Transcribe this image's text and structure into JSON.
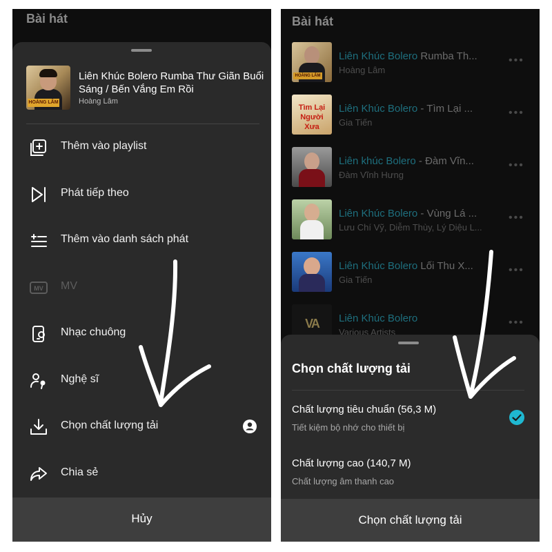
{
  "left": {
    "section_title": "Bài hát",
    "song": {
      "title": "Liên Khúc Bolero Rumba Thư Giãn Buổi Sáng / Bến Vắng Em Rồi",
      "artist": "Hoàng Lâm",
      "cover_name": "HOÀNG LÂM"
    },
    "menu": [
      {
        "label": "Thêm vào playlist",
        "icon": "add-to-playlist-icon"
      },
      {
        "label": "Phát tiếp theo",
        "icon": "play-next-icon"
      },
      {
        "label": "Thêm vào danh sách phát",
        "icon": "add-to-queue-icon"
      },
      {
        "label": "MV",
        "icon": "mv-icon",
        "disabled": true
      },
      {
        "label": "Nhạc chuông",
        "icon": "ringtone-icon"
      },
      {
        "label": "Nghệ sĩ",
        "icon": "artist-icon"
      },
      {
        "label": "Chọn chất lượng tải",
        "icon": "download-icon",
        "badge": "account-lock-icon"
      },
      {
        "label": "Chia sẻ",
        "icon": "share-icon"
      }
    ],
    "cancel_label": "Hủy"
  },
  "right": {
    "section_title": "Bài hát",
    "songs": [
      {
        "title_highlight": "Liên Khúc Bolero",
        "title_rest": " Rumba Th...",
        "subtitle": "Hoàng Lâm",
        "dots": "•••",
        "thumb_text": "HOÀNG LÂM"
      },
      {
        "title_highlight": "Liên Khúc Bolero",
        "title_rest": " - Tìm Lại ...",
        "subtitle": "Gia Tiến",
        "dots": "•••",
        "thumb_text": "Tìm Lại Người Xưa"
      },
      {
        "title_highlight": "Liên khúc Bolero",
        "title_rest": " - Đàm Vĩn...",
        "subtitle": "Đàm Vĩnh Hưng",
        "dots": "•••",
        "thumb_text": ""
      },
      {
        "title_highlight": "Liên Khúc Bolero",
        "title_rest": " - Vùng Lá ...",
        "subtitle": "Lưu Chí Vỹ, Diễm Thùy, Lý Diệu L...",
        "dots": "•••",
        "thumb_text": ""
      },
      {
        "title_highlight": "Liên Khúc Bolero",
        "title_rest": " Lối Thu X...",
        "subtitle": "Gia Tiến",
        "dots": "•••",
        "thumb_text": ""
      },
      {
        "title_highlight": "Liên Khúc Bolero",
        "title_rest": "",
        "subtitle": "Various Artists",
        "dots": "•••",
        "thumb_text": "VA"
      }
    ],
    "quality_sheet": {
      "title": "Chọn chất lượng tải",
      "options": [
        {
          "label": "Chất lượng tiêu chuẩn (56,3 M)",
          "sub": "Tiết kiệm bộ nhớ cho thiết bị",
          "selected": true
        },
        {
          "label": "Chất lượng cao (140,7 M)",
          "sub": "Chất lượng âm thanh cao",
          "selected": false
        }
      ],
      "confirm_label": "Chọn chất lượng tải"
    }
  },
  "colors": {
    "accent": "#1fb8d1",
    "highlight_dim": "#1e6f7e",
    "sheet_bg": "#2a2a2a",
    "screen_bg": "#0e0e0e"
  }
}
